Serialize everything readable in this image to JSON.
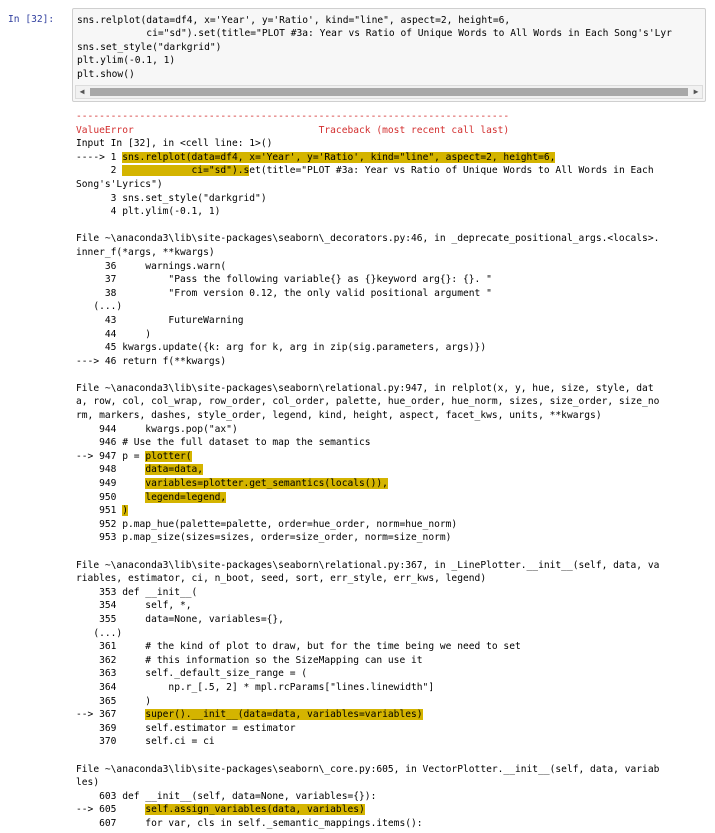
{
  "prompt": "In [32]:",
  "input_lines": [
    "sns.relplot(data=df4, x='Year', y='Ratio', kind=\"line\", aspect=2, height=6,",
    "            ci=\"sd\").set(title=\"PLOT #3a: Year vs Ratio of Unique Words to All Words in Each Song's'Lyr",
    "sns.set_style(\"darkgrid\")",
    "plt.ylim(-0.1, 1)",
    "plt.show()"
  ],
  "output_lines": [
    {
      "cls": "red",
      "text": "---------------------------------------------------------------------------"
    },
    {
      "cls": "red",
      "text": "ValueError                                Traceback (most recent call last)"
    },
    {
      "cls": "",
      "text": "Input In [32], in <cell line: 1>()"
    },
    {
      "cls": "",
      "text": "----> 1 sns.relplot(data=df4, x='Year', y='Ratio', kind=\"line\", aspect=2, height=6,"
    },
    {
      "cls": "",
      "text": "      2             ci=\"sd\").set(title=\"PLOT #3a: Year vs Ratio of Unique Words to All Words in Each"
    },
    {
      "cls": "",
      "text": "Song's'Lyrics\")"
    },
    {
      "cls": "",
      "text": "      3 sns.set_style(\"darkgrid\")"
    },
    {
      "cls": "",
      "text": "      4 plt.ylim(-0.1, 1)"
    },
    {
      "cls": "blank",
      "text": ""
    },
    {
      "cls": "",
      "text": "File ~\\anaconda3\\lib\\site-packages\\seaborn\\_decorators.py:46, in _deprecate_positional_args.<locals>."
    },
    {
      "cls": "",
      "text": "inner_f(*args, **kwargs)"
    },
    {
      "cls": "",
      "text": "     36     warnings.warn("
    },
    {
      "cls": "",
      "text": "     37         \"Pass the following variable{} as {}keyword arg{}: {}. \""
    },
    {
      "cls": "",
      "text": "     38         \"From version 0.12, the only valid positional argument \""
    },
    {
      "cls": "",
      "text": "   (...)"
    },
    {
      "cls": "",
      "text": "     43         FutureWarning"
    },
    {
      "cls": "",
      "text": "     44     )"
    },
    {
      "cls": "",
      "text": "     45 kwargs.update({k: arg for k, arg in zip(sig.parameters, args)})"
    },
    {
      "cls": "",
      "text": "---> 46 return f(**kwargs)"
    },
    {
      "cls": "blank",
      "text": ""
    },
    {
      "cls": "",
      "text": "File ~\\anaconda3\\lib\\site-packages\\seaborn\\relational.py:947, in relplot(x, y, hue, size, style, dat"
    },
    {
      "cls": "",
      "text": "a, row, col, col_wrap, row_order, col_order, palette, hue_order, hue_norm, sizes, size_order, size_no"
    },
    {
      "cls": "",
      "text": "rm, markers, dashes, style_order, legend, kind, height, aspect, facet_kws, units, **kwargs)"
    },
    {
      "cls": "",
      "text": "    944     kwargs.pop(\"ax\")"
    },
    {
      "cls": "",
      "text": "    946 # Use the full dataset to map the semantics"
    },
    {
      "cls": "",
      "text": "--> 947 p = plotter("
    },
    {
      "cls": "",
      "text": "    948     data=data,"
    },
    {
      "cls": "",
      "text": "    949     variables=plotter.get_semantics(locals()),"
    },
    {
      "cls": "",
      "text": "    950     legend=legend,"
    },
    {
      "cls": "",
      "text": "    951 )"
    },
    {
      "cls": "",
      "text": "    952 p.map_hue(palette=palette, order=hue_order, norm=hue_norm)"
    },
    {
      "cls": "",
      "text": "    953 p.map_size(sizes=sizes, order=size_order, norm=size_norm)"
    },
    {
      "cls": "blank",
      "text": ""
    },
    {
      "cls": "",
      "text": "File ~\\anaconda3\\lib\\site-packages\\seaborn\\relational.py:367, in _LinePlotter.__init__(self, data, va"
    },
    {
      "cls": "",
      "text": "riables, estimator, ci, n_boot, seed, sort, err_style, err_kws, legend)"
    },
    {
      "cls": "",
      "text": "    353 def __init__("
    },
    {
      "cls": "",
      "text": "    354     self, *,"
    },
    {
      "cls": "",
      "text": "    355     data=None, variables={},"
    },
    {
      "cls": "",
      "text": "   (...)"
    },
    {
      "cls": "",
      "text": "    361     # the kind of plot to draw, but for the time being we need to set"
    },
    {
      "cls": "",
      "text": "    362     # this information so the SizeMapping can use it"
    },
    {
      "cls": "",
      "text": "    363     self._default_size_range = ("
    },
    {
      "cls": "",
      "text": "    364         np.r_[.5, 2] * mpl.rcParams[\"lines.linewidth\"]"
    },
    {
      "cls": "",
      "text": "    365     )"
    },
    {
      "cls": "",
      "text": "--> 367     super().__init__(data=data, variables=variables)"
    },
    {
      "cls": "",
      "text": "    369     self.estimator = estimator"
    },
    {
      "cls": "",
      "text": "    370     self.ci = ci"
    },
    {
      "cls": "blank",
      "text": ""
    },
    {
      "cls": "",
      "text": "File ~\\anaconda3\\lib\\site-packages\\seaborn\\_core.py:605, in VectorPlotter.__init__(self, data, variab"
    },
    {
      "cls": "",
      "text": "les)"
    },
    {
      "cls": "",
      "text": "    603 def __init__(self, data=None, variables={}):"
    },
    {
      "cls": "",
      "text": "--> 605     self.assign_variables(data, variables)"
    },
    {
      "cls": "",
      "text": "    607     for var, cls in self._semantic_mappings.items():"
    }
  ]
}
